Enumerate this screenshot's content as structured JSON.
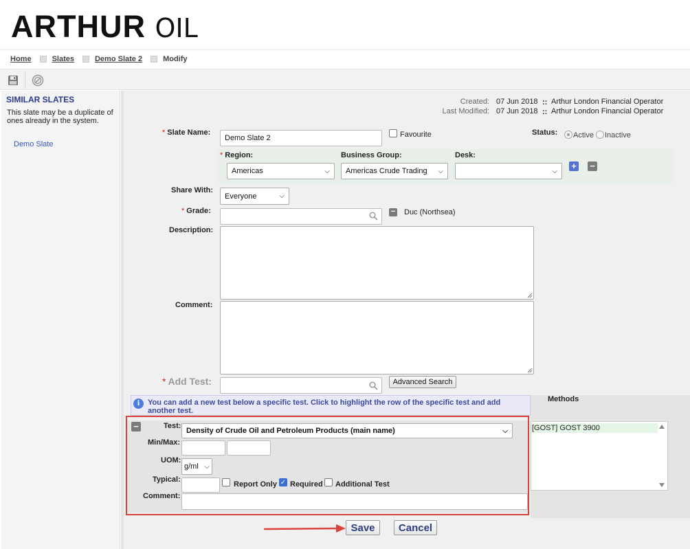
{
  "brand": {
    "word1": "ARTHUR",
    "word2": "OIL"
  },
  "breadcrumb": [
    "Home",
    "Slates",
    "Demo Slate 2",
    "Modify"
  ],
  "toolbar": {
    "save_icon": "floppy-disk-icon",
    "cancel_icon": "cancel-circle-icon"
  },
  "sidebar": {
    "title": "SIMILAR SLATES",
    "text": "This slate may be a duplicate of ones already in the system.",
    "links": [
      "Demo Slate"
    ]
  },
  "meta": {
    "created_label": "Created:",
    "created_date": "07 Jun 2018",
    "created_by": "Arthur London Financial Operator",
    "modified_label": "Last Modified:",
    "modified_date": "07 Jun 2018",
    "modified_by": "Arthur London Financial Operator",
    "sep": "::"
  },
  "form": {
    "slate_name_label": "Slate Name:",
    "slate_name_value": "Demo Slate 2",
    "favourite_label": "Favourite",
    "status_label": "Status:",
    "status_active": "Active",
    "status_inactive": "Inactive",
    "region_label": "Region:",
    "region_value": "Americas",
    "business_group_label": "Business Group:",
    "business_group_value": "Americas Crude Trading",
    "desk_label": "Desk:",
    "desk_value": "",
    "share_with_label": "Share With:",
    "share_with_value": "Everyone",
    "grade_label": "Grade:",
    "grade_value": "",
    "grade_tag": "Duc (Northsea)",
    "description_label": "Description:",
    "comment_label": "Comment:",
    "add_test_label": "Add Test:",
    "advanced_search_label": "Advanced Search"
  },
  "info": {
    "text": "You can add a new test below a specific test. Click to highlight the row of the specific test and add another test.",
    "methods_label": "Methods"
  },
  "test": {
    "test_label": "Test:",
    "test_value": "Density of Crude Oil and Petroleum Products (main name)",
    "minmax_label": "Min/Max:",
    "uom_label": "UOM:",
    "uom_value": "g/ml",
    "typical_label": "Typical:",
    "report_only_label": "Report Only",
    "required_label": "Required",
    "additional_label": "Additional Test",
    "comment_label": "Comment:",
    "methods": [
      "[GOST] GOST 3900"
    ]
  },
  "actions": {
    "save": "Save",
    "cancel": "Cancel"
  },
  "colors": {
    "brand_blue": "#2a3a8e",
    "required_red": "#cc2222",
    "highlight_red": "#d9413c"
  }
}
